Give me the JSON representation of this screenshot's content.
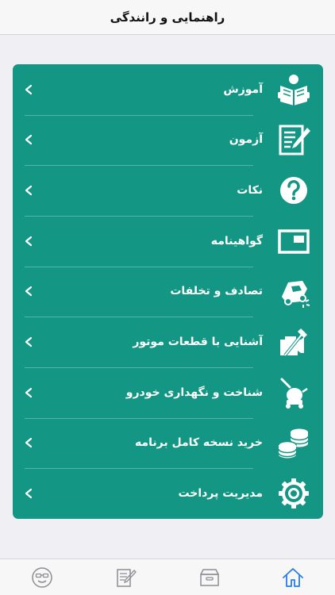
{
  "header": {
    "title": "راهنمایی و رانندگی"
  },
  "menu": {
    "items": [
      {
        "label": "آموزش",
        "icon": "reading-person-icon"
      },
      {
        "label": "آزمون",
        "icon": "exam-sheet-pencil-icon"
      },
      {
        "label": "نکات",
        "icon": "question-circle-icon"
      },
      {
        "label": "گواهینامه",
        "icon": "license-card-icon"
      },
      {
        "label": "تصادف و تخلفات",
        "icon": "car-crash-icon"
      },
      {
        "label": "آشنایی با قطعات موتور",
        "icon": "engine-tools-icon"
      },
      {
        "label": "شناخت و نگهداری خودرو",
        "icon": "car-maintenance-icon"
      },
      {
        "label": "خرید نسخه کامل برنامه",
        "icon": "coins-stack-icon"
      },
      {
        "label": "مدیریت پرداخت",
        "icon": "gear-icon"
      }
    ]
  },
  "tabbar": {
    "tabs": [
      {
        "icon": "smiley-glasses-icon"
      },
      {
        "icon": "exam-pencil-icon"
      },
      {
        "icon": "archive-box-icon"
      },
      {
        "icon": "home-icon",
        "active": true
      }
    ]
  },
  "colors": {
    "accent": "#139784",
    "tab_active": "#2a7de1",
    "tab_inactive": "#8e8e93"
  }
}
